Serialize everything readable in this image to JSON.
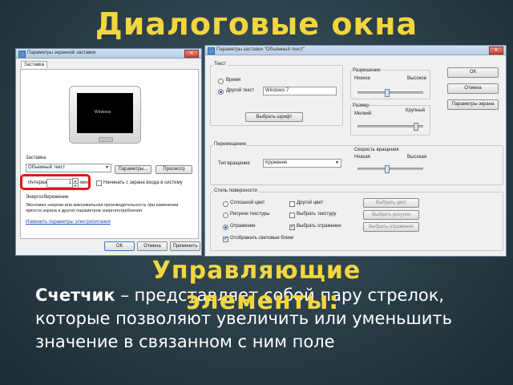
{
  "slide": {
    "title": "Диалоговые окна",
    "subtitle_line1": "Управляющие",
    "subtitle_line2": "элементы:",
    "term": "Счетчик",
    "description": " – представляет собой пару стрелок, которые позволяют увеличить или уменьшить значение в связанном с ним поле",
    "colors": {
      "title": "#f2d640",
      "text": "#ffffff",
      "highlight": "#e01818"
    }
  },
  "screensaver_dialog": {
    "title": "Параметры экранной заставки",
    "tab": "Заставка",
    "preview_text": "Windows",
    "screensaver_group_label": "Заставка",
    "screensaver_select": "Объемный текст",
    "options_button": "Параметры...",
    "preview_button": "Просмотр",
    "interval_label": "Интервал:",
    "interval_value": "1",
    "interval_unit": "мин.",
    "logon_checkbox": "Начинать с экрана входа в систему",
    "power_group_label": "Энергосбережение",
    "power_text": "Экономия энергии или максимальная производительность при изменении яркости экрана и других параметров энергопотребления.",
    "power_link": "Изменить параметры электропитания",
    "ok_button": "ОК",
    "cancel_button": "Отмена",
    "apply_button": "Применить"
  },
  "text3d_dialog": {
    "title": "Параметры заставки \"Объемный текст\"",
    "text_group": "Текст",
    "time_radio": "Время",
    "custom_text_radio": "Другой текст",
    "custom_text_value": "Windows 7",
    "font_button": "Выбрать шрифт",
    "resolution_label": "Разрешение",
    "resolution_low": "Низкое",
    "resolution_high": "Высокое",
    "size_label": "Размер",
    "size_small": "Мелкий",
    "size_large": "Крупный",
    "ok_button": "ОК",
    "cancel_button": "Отмена",
    "screen_settings_button": "Параметры экрана",
    "motion_group": "Перемещение",
    "rotation_label": "Тип вращения",
    "rotation_value": "Кружение",
    "speed_label": "Скорость вращения",
    "speed_low": "Низкая",
    "speed_high": "Высокая",
    "surface_group": "Стиль поверхности",
    "solid_color": "Сплошной цвет",
    "texture_radio": "Рисунок текстуры",
    "reflection_radio": "Отражение",
    "custom_color": "Другой цвет",
    "custom_texture": "Выбрать текстуру",
    "custom_reflection": "Выбрать отражение",
    "pick_color": "Выбрать цвет",
    "pick_picture": "Выбрать рисунок",
    "pick_reflection": "Выбрать отражение",
    "specular_checkbox": "Отображать световые блики"
  }
}
